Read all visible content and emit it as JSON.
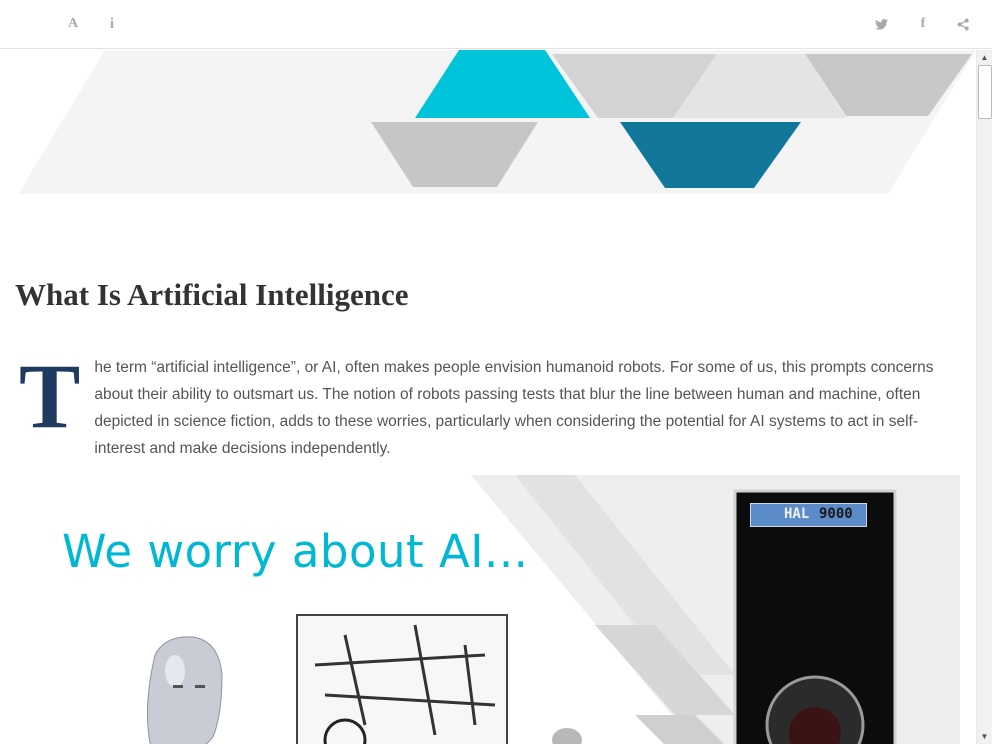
{
  "toolbar": {
    "font_icon": "A",
    "info_icon": "i",
    "facebook_icon": "f"
  },
  "icons": [
    "font-size-icon",
    "info-icon",
    "twitter-icon",
    "facebook-icon",
    "share-icon"
  ],
  "colors": {
    "accent_cyan": "#00c4d9",
    "accent_teal": "#11789b",
    "heading": "#333333",
    "body_text": "#555555",
    "dropcap": "#1f3a5f",
    "hal_badge": "#5b8cc9"
  },
  "article": {
    "title": "What Is Artificial Intelligence",
    "dropcap": "T",
    "body": "he term “artificial intelligence”, or AI, often makes people envision humanoid robots. For some of us, this prompts concerns about their ability to outsmart us. The notion of robots passing tests that blur the line between human and machine, often depicted in science fiction, adds to these worries, particularly when considering the potential for AI systems to act in self-interest and make decisions independently."
  },
  "figure": {
    "headline": "We worry about AI...",
    "hal_label_a": "HAL",
    "hal_label_b": "9000"
  }
}
